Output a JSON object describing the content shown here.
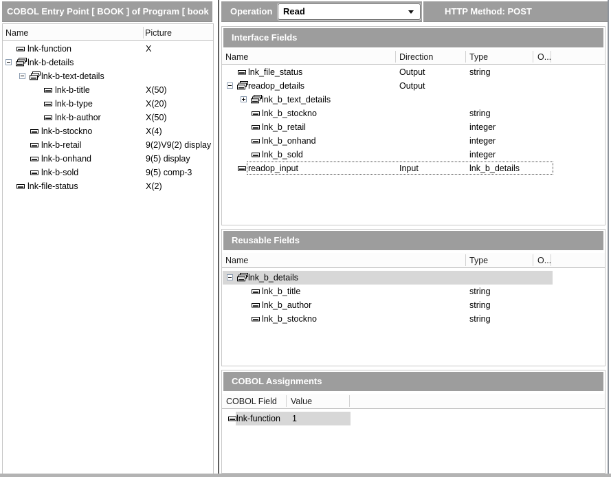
{
  "left_panel": {
    "title": "COBOL Entry Point [ BOOK ] of Program [ book",
    "columns": {
      "name": "Name",
      "picture": "Picture"
    },
    "rows": [
      {
        "name": "lnk-function",
        "picture": "X",
        "level": 0,
        "icon": "field"
      },
      {
        "name": "lnk-b-details",
        "picture": "",
        "level": 0,
        "icon": "group",
        "expander": "minus"
      },
      {
        "name": "lnk-b-text-details",
        "picture": "",
        "level": 1,
        "icon": "group",
        "expander": "minus"
      },
      {
        "name": "lnk-b-title",
        "picture": "X(50)",
        "level": 2,
        "icon": "field"
      },
      {
        "name": "lnk-b-type",
        "picture": "X(20)",
        "level": 2,
        "icon": "field"
      },
      {
        "name": "lnk-b-author",
        "picture": "X(50)",
        "level": 2,
        "icon": "field"
      },
      {
        "name": "lnk-b-stockno",
        "picture": "X(4)",
        "level": 1,
        "icon": "field"
      },
      {
        "name": "lnk-b-retail",
        "picture": "9(2)V9(2) display",
        "level": 1,
        "icon": "field"
      },
      {
        "name": "lnk-b-onhand",
        "picture": "9(5) display",
        "level": 1,
        "icon": "field"
      },
      {
        "name": "lnk-b-sold",
        "picture": "9(5) comp-3",
        "level": 1,
        "icon": "field"
      },
      {
        "name": "lnk-file-status",
        "picture": "X(2)",
        "level": 0,
        "icon": "field"
      }
    ]
  },
  "operation_bar": {
    "label": "Operation",
    "dropdown_value": "Read",
    "http_method": "HTTP Method: POST"
  },
  "interface_fields": {
    "title": "Interface Fields",
    "columns": {
      "name": "Name",
      "direction": "Direction",
      "type": "Type",
      "occurs": "O..."
    },
    "rows": [
      {
        "name": "lnk_file_status",
        "direction": "Output",
        "type": "string",
        "level": 0,
        "icon": "field"
      },
      {
        "name": "readop_details",
        "direction": "Output",
        "type": "",
        "level": 0,
        "icon": "group",
        "expander": "minus"
      },
      {
        "name": "lnk_b_text_details",
        "direction": "",
        "type": "",
        "level": 1,
        "icon": "group",
        "expander": "plus"
      },
      {
        "name": "lnk_b_stockno",
        "direction": "",
        "type": "string",
        "level": 1,
        "icon": "field"
      },
      {
        "name": "lnk_b_retail",
        "direction": "",
        "type": "integer",
        "level": 1,
        "icon": "field"
      },
      {
        "name": "lnk_b_onhand",
        "direction": "",
        "type": "integer",
        "level": 1,
        "icon": "field"
      },
      {
        "name": "lnk_b_sold",
        "direction": "",
        "type": "integer",
        "level": 1,
        "icon": "field"
      },
      {
        "name": "readop_input",
        "direction": "Input",
        "type": "lnk_b_details",
        "level": 0,
        "icon": "field",
        "focused": true
      }
    ]
  },
  "reusable_fields": {
    "title": "Reusable Fields",
    "columns": {
      "name": "Name",
      "type": "Type",
      "occurs": "O..."
    },
    "rows": [
      {
        "name": "lnk_b_details",
        "type": "",
        "level": 0,
        "icon": "group",
        "expander": "minus",
        "highlight": true
      },
      {
        "name": "lnk_b_title",
        "type": "string",
        "level": 1,
        "icon": "field"
      },
      {
        "name": "lnk_b_author",
        "type": "string",
        "level": 1,
        "icon": "field"
      },
      {
        "name": "lnk_b_stockno",
        "type": "string",
        "level": 1,
        "icon": "field"
      }
    ]
  },
  "cobol_assignments": {
    "title": "COBOL Assignments",
    "columns": {
      "field": "COBOL Field",
      "value": "Value"
    },
    "rows": [
      {
        "name": "lnk-function",
        "value": "1",
        "level": 0,
        "icon": "field",
        "highlight": true
      }
    ]
  },
  "colors": {
    "header_bar_gray": "#9d9d9d",
    "row_highlight_gray": "#d7d7d7"
  }
}
